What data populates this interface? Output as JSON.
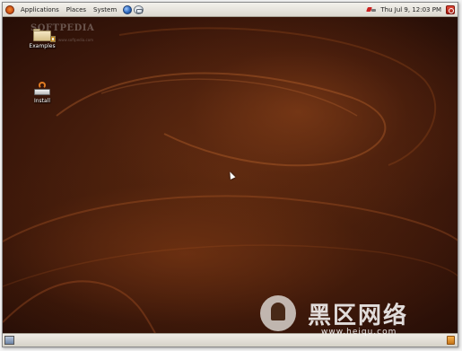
{
  "top_panel": {
    "menus": [
      "Applications",
      "Places",
      "System"
    ],
    "clock": "Thu Jul  9, 12:03 PM"
  },
  "watermark": {
    "text": "SOFTPEDIA",
    "url": "www.softpedia.com"
  },
  "desktop": {
    "icons": [
      {
        "label": "Examples",
        "icon": "folder-icon"
      },
      {
        "label": "Install",
        "icon": "install-icon"
      }
    ]
  },
  "overlay": {
    "site_name": "黑区网络",
    "site_url": "www.heiqu.com"
  },
  "colors": {
    "panel": "#dcd8cf",
    "desktop_dark": "#1a0804",
    "desktop_mid": "#5d2a10",
    "accent": "#c84a10"
  }
}
